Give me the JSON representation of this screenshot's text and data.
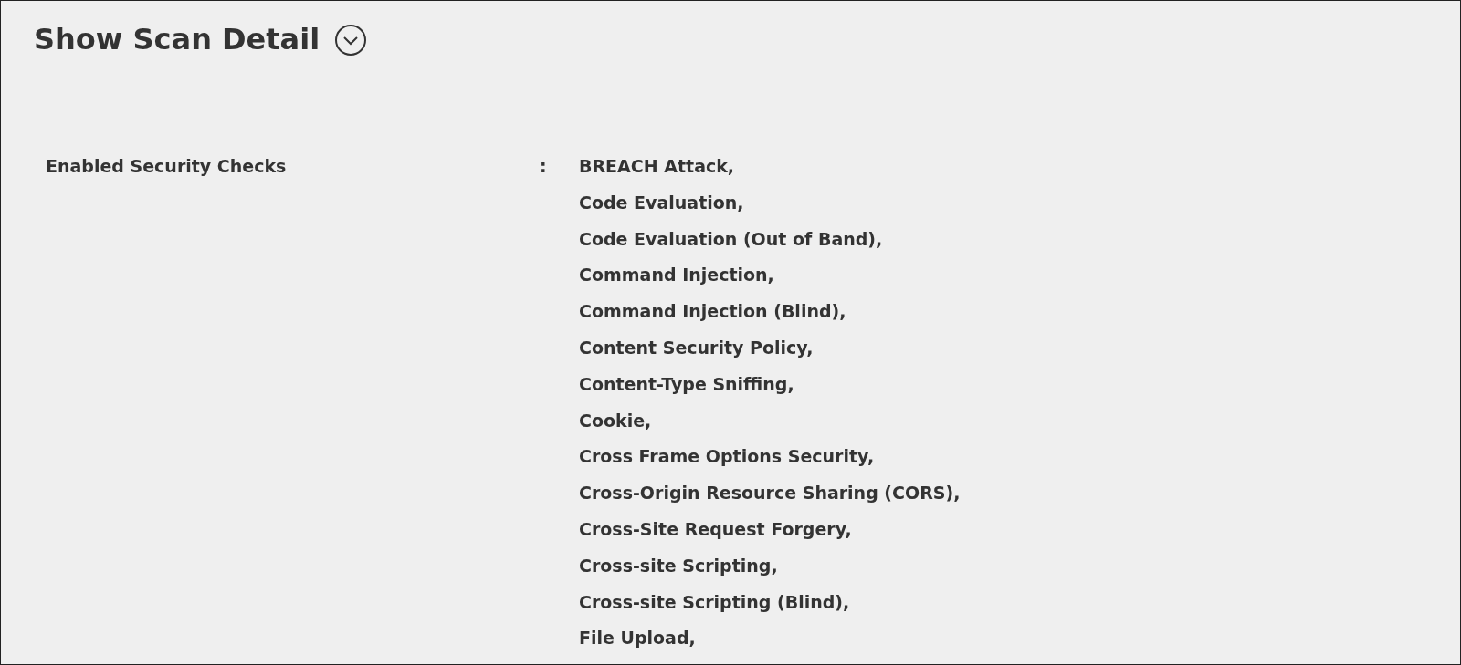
{
  "title": "Show Scan Detail",
  "fields": [
    {
      "label": "Enabled Security Checks",
      "separator": ":",
      "values": [
        "BREACH Attack,",
        "Code Evaluation,",
        "Code Evaluation (Out of Band),",
        "Command Injection,",
        "Command Injection (Blind),",
        "Content Security Policy,",
        "Content-Type Sniffing,",
        "Cookie,",
        "Cross Frame Options Security,",
        "Cross-Origin Resource Sharing (CORS),",
        "Cross-Site Request Forgery,",
        "Cross-site Scripting,",
        "Cross-site Scripting (Blind),",
        "File Upload,"
      ]
    }
  ]
}
